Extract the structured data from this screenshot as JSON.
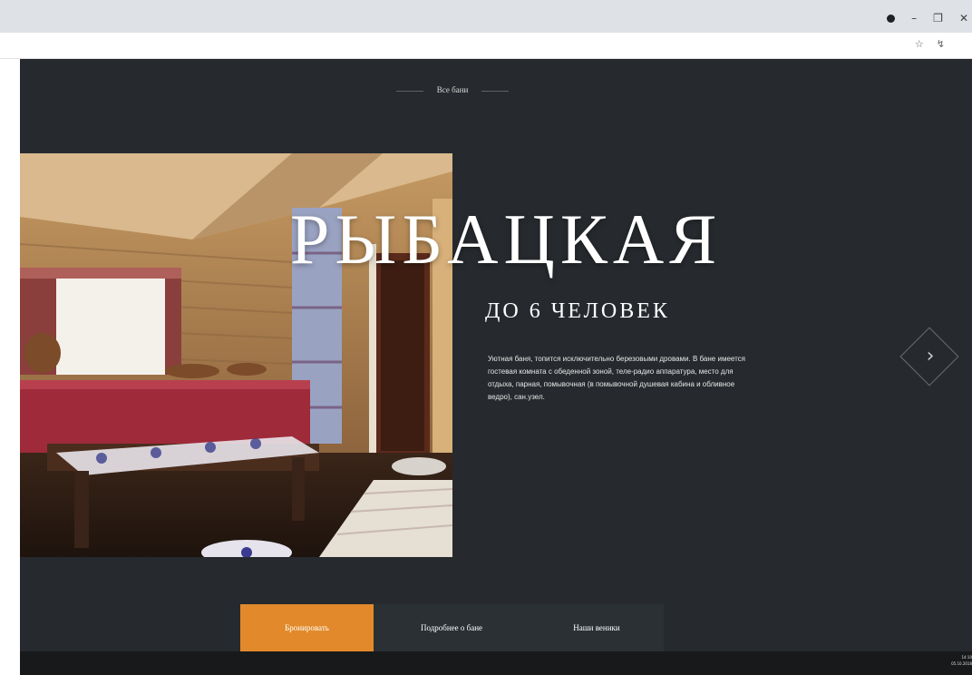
{
  "browser": {
    "window_controls": [
      "–",
      "❐",
      "✕"
    ],
    "address_icons": [
      "☆",
      "↯"
    ]
  },
  "page": {
    "all_link": "Все бани",
    "title": "РЫБАЦКАЯ",
    "subtitle": "ДО 6 ЧЕЛОВЕК",
    "description": "Уютная баня, топится исключительно березовыми дровами. В бане имеется гостевая комната с обеденной зоной, теле-радио аппаратура, место для отдыха, парная, помывочная (в помывочной душевая кабина и обливное ведро), сан.узел.",
    "next_glyph": "›",
    "buttons": {
      "book": "Бронировать",
      "details": "Подробнее о бане",
      "brooms": "Наши веники"
    },
    "accent_color": "#e28a2b",
    "background_color": "#262a2e"
  },
  "taskbar": {
    "time": "14:10",
    "date": "05.10.2018"
  }
}
